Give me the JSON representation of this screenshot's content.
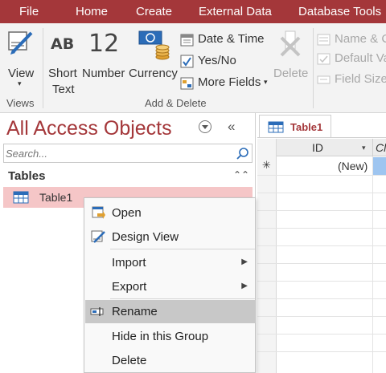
{
  "menubar": {
    "tabs": [
      "File",
      "Home",
      "Create",
      "External Data",
      "Database Tools"
    ]
  },
  "ribbon": {
    "view": {
      "label": "View"
    },
    "short_text": {
      "glyph": "AB",
      "label_line1": "Short",
      "label_line2": "Text"
    },
    "number": {
      "glyph": "12",
      "label": "Number"
    },
    "currency": {
      "label": "Currency"
    },
    "date_time": {
      "label": "Date & Time"
    },
    "yes_no": {
      "label": "Yes/No"
    },
    "more_fields": {
      "label": "More Fields"
    },
    "delete": {
      "label": "Delete"
    },
    "name_caption": {
      "label": "Name & C"
    },
    "default_value": {
      "label": "Default Va"
    },
    "field_size": {
      "label": "Field Size"
    },
    "groups": {
      "views": "Views",
      "add_delete": "Add & Delete"
    }
  },
  "nav": {
    "title": "All Access Objects",
    "search_placeholder": "Search...",
    "section": "Tables",
    "items": [
      {
        "label": "Table1"
      }
    ]
  },
  "document": {
    "tab_label": "Table1",
    "columns": {
      "id": "ID",
      "next": "Cl"
    },
    "new_row_value": "(New)",
    "new_row_marker": "✳"
  },
  "context_menu": {
    "items": [
      {
        "label": "Open"
      },
      {
        "label": "Design View"
      },
      {
        "label": "Import"
      },
      {
        "label": "Export"
      },
      {
        "label": "Rename"
      },
      {
        "label": "Hide in this Group"
      },
      {
        "label": "Delete"
      }
    ]
  },
  "colors": {
    "accent": "#a4373a",
    "selection": "#f5c6c7",
    "menu_hover": "#c8c8c8"
  }
}
